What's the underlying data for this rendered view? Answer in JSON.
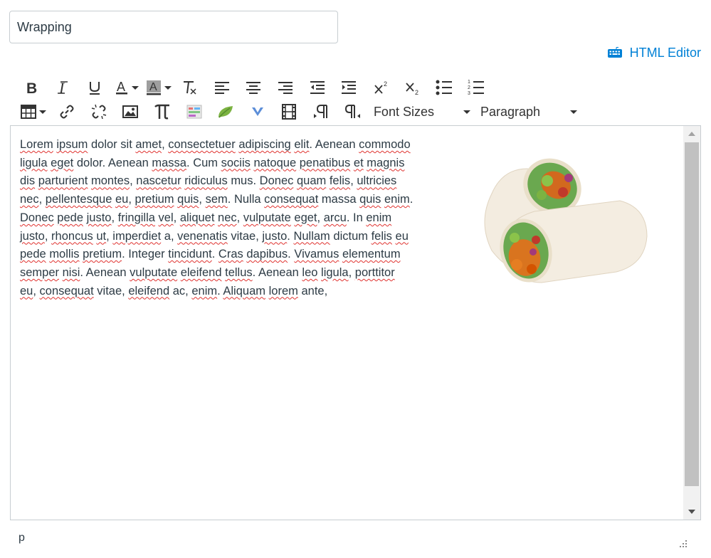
{
  "title_field": {
    "value": "Wrapping"
  },
  "html_editor": {
    "label": "HTML Editor",
    "icon": "keyboard-icon",
    "color": "#0081d6"
  },
  "toolbar": {
    "row1": [
      {
        "name": "bold-button",
        "icon": "bold-icon"
      },
      {
        "name": "italic-button",
        "icon": "italic-icon"
      },
      {
        "name": "underline-button",
        "icon": "underline-icon"
      },
      {
        "name": "text-color-button",
        "icon": "text-color-icon",
        "dropdown": true
      },
      {
        "name": "background-color-button",
        "icon": "background-color-icon",
        "dropdown": true
      },
      {
        "name": "clear-formatting-button",
        "icon": "clear-formatting-icon"
      },
      {
        "name": "align-left-button",
        "icon": "align-left-icon"
      },
      {
        "name": "align-center-button",
        "icon": "align-center-icon"
      },
      {
        "name": "align-right-button",
        "icon": "align-right-icon"
      },
      {
        "name": "outdent-button",
        "icon": "outdent-icon"
      },
      {
        "name": "indent-button",
        "icon": "indent-icon"
      },
      {
        "name": "superscript-button",
        "icon": "superscript-icon"
      },
      {
        "name": "subscript-button",
        "icon": "subscript-icon"
      },
      {
        "name": "bullet-list-button",
        "icon": "bullet-list-icon"
      },
      {
        "name": "numbered-list-button",
        "icon": "numbered-list-icon"
      }
    ],
    "row2": [
      {
        "name": "table-button",
        "icon": "table-icon",
        "dropdown": true
      },
      {
        "name": "link-button",
        "icon": "link-icon"
      },
      {
        "name": "unlink-button",
        "icon": "unlink-icon"
      },
      {
        "name": "image-button",
        "icon": "image-icon"
      },
      {
        "name": "math-equation-button",
        "icon": "pi-icon"
      },
      {
        "name": "media-embed-button",
        "icon": "embed-icon"
      },
      {
        "name": "leaf-tool-button",
        "icon": "leaf-icon"
      },
      {
        "name": "v-tool-button",
        "icon": "v-icon"
      },
      {
        "name": "media-button",
        "icon": "film-icon"
      },
      {
        "name": "ltr-button",
        "icon": "paragraph-ltr-icon"
      },
      {
        "name": "rtl-button",
        "icon": "paragraph-rtl-icon"
      }
    ],
    "font_sizes_label": "Font Sizes",
    "paragraph_label": "Paragraph"
  },
  "editor": {
    "words": [
      [
        "Lorem",
        true
      ],
      [
        "ipsum",
        true
      ],
      [
        "dolor",
        false
      ],
      [
        "sit",
        false
      ],
      [
        "amet,",
        true
      ],
      [
        "consectetuer",
        true
      ],
      [
        "adipiscing",
        true
      ],
      [
        "elit.",
        true
      ],
      [
        "Aenean",
        false
      ],
      [
        "commodo",
        true
      ],
      [
        "ligula",
        true
      ],
      [
        "eget",
        true
      ],
      [
        "dolor.",
        false
      ],
      [
        "Aenean",
        false
      ],
      [
        "massa.",
        true
      ],
      [
        "Cum",
        false
      ],
      [
        "sociis",
        true
      ],
      [
        "natoque",
        true
      ],
      [
        "penatibus",
        true
      ],
      [
        "et",
        true
      ],
      [
        "magnis",
        true
      ],
      [
        "dis",
        true
      ],
      [
        "parturient",
        true
      ],
      [
        "montes,",
        true
      ],
      [
        "nascetur",
        true
      ],
      [
        "ridiculus",
        true
      ],
      [
        "mus.",
        false
      ],
      [
        "Donec",
        true
      ],
      [
        "quam",
        true
      ],
      [
        "felis,",
        true
      ],
      [
        "ultricies",
        true
      ],
      [
        "nec,",
        true
      ],
      [
        "pellentesque",
        true
      ],
      [
        "eu,",
        true
      ],
      [
        "pretium",
        true
      ],
      [
        "quis,",
        true
      ],
      [
        "sem.",
        true
      ],
      [
        "Nulla",
        false
      ],
      [
        "consequat",
        true
      ],
      [
        "massa",
        false
      ],
      [
        "quis",
        true
      ],
      [
        "enim.",
        true
      ],
      [
        "Donec",
        true
      ],
      [
        "pede",
        true
      ],
      [
        "justo,",
        true
      ],
      [
        "fringilla",
        true
      ],
      [
        "vel,",
        true
      ],
      [
        "aliquet",
        true
      ],
      [
        "nec,",
        true
      ],
      [
        "vulputate",
        true
      ],
      [
        "eget,",
        true
      ],
      [
        "arcu.",
        true
      ],
      [
        "In",
        false
      ],
      [
        "enim",
        true
      ],
      [
        "justo,",
        true
      ],
      [
        "rhoncus",
        true
      ],
      [
        "ut,",
        true
      ],
      [
        "imperdiet",
        true
      ],
      [
        "a,",
        false
      ],
      [
        "venenatis",
        true
      ],
      [
        "vitae,",
        false
      ],
      [
        "justo.",
        true
      ],
      [
        "Nullam",
        true
      ],
      [
        "dictum",
        false
      ],
      [
        "felis",
        true
      ],
      [
        "eu",
        true
      ],
      [
        "pede",
        true
      ],
      [
        "mollis",
        true
      ],
      [
        "pretium.",
        true
      ],
      [
        "Integer",
        false
      ],
      [
        "tincidunt.",
        true
      ],
      [
        "Cras",
        true
      ],
      [
        "dapibus.",
        true
      ],
      [
        "Vivamus",
        true
      ],
      [
        "elementum",
        true
      ],
      [
        "semper",
        true
      ],
      [
        "nisi.",
        true
      ],
      [
        "Aenean",
        false
      ],
      [
        "vulputate",
        true
      ],
      [
        "eleifend",
        true
      ],
      [
        "tellus.",
        true
      ],
      [
        "Aenean",
        false
      ],
      [
        "leo",
        true
      ],
      [
        "ligula,",
        true
      ],
      [
        "porttitor",
        true
      ],
      [
        "eu,",
        true
      ],
      [
        "consequat",
        true
      ],
      [
        "vitae,",
        false
      ],
      [
        "eleifend",
        true
      ],
      [
        "ac,",
        false
      ],
      [
        "enim.",
        true
      ],
      [
        "Aliquam",
        true
      ],
      [
        "lorem",
        true
      ],
      [
        "ante,",
        false
      ]
    ],
    "line_breaks_after": [
      9,
      20,
      30,
      41,
      53,
      65,
      74,
      84
    ],
    "image_alt": "wrap-sandwich-image"
  },
  "status_bar": {
    "path": "p"
  },
  "colors": {
    "link": "#0081d6",
    "spellcheck": "#e0322f",
    "scroll_thumb": "#c1c1c1",
    "border": "#c7cdd1"
  }
}
